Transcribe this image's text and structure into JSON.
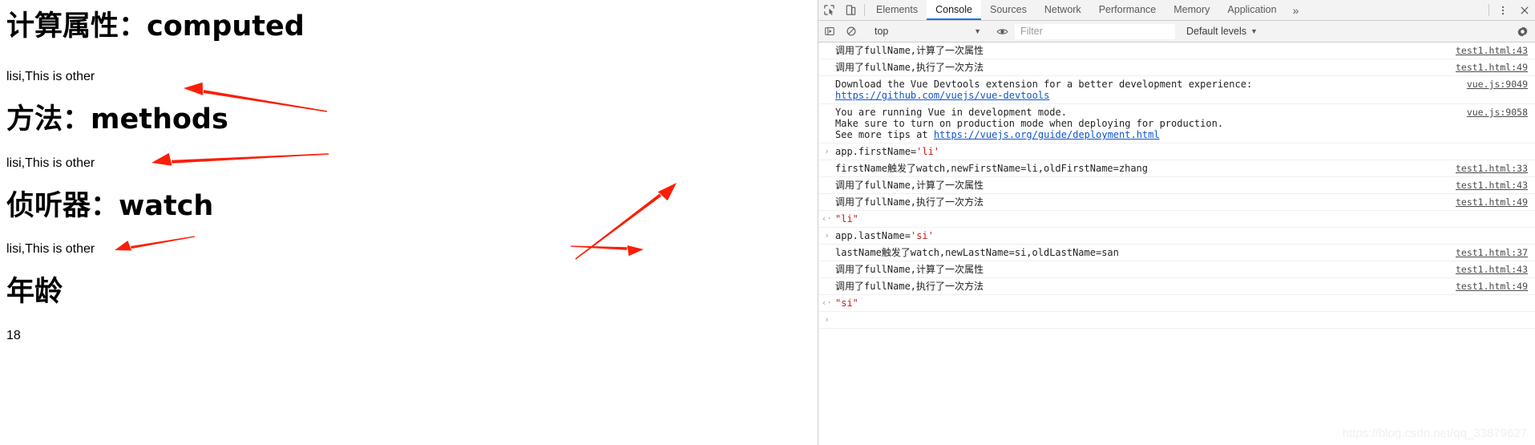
{
  "page": {
    "sections": [
      {
        "heading": "计算属性：computed",
        "value": "lisi,This is other"
      },
      {
        "heading": "方法：methods",
        "value": "lisi,This is other"
      },
      {
        "heading": "侦听器：watch",
        "value": "lisi,This is other"
      },
      {
        "heading": "年龄",
        "value": "18"
      }
    ]
  },
  "devtools": {
    "icons": {
      "inspect": "inspect-element-icon",
      "device": "device-toolbar-icon",
      "sidebar": "console-sidebar-icon",
      "clear": "clear-console-icon",
      "eye": "live-expression-icon",
      "more_tabs": "more-tabs-icon",
      "menu": "customize-devtools-icon",
      "close": "close-devtools-icon",
      "settings": "settings-gear-icon"
    },
    "tabs": [
      {
        "label": "Elements",
        "selected": false
      },
      {
        "label": "Console",
        "selected": true
      },
      {
        "label": "Sources",
        "selected": false
      },
      {
        "label": "Network",
        "selected": false
      },
      {
        "label": "Performance",
        "selected": false
      },
      {
        "label": "Memory",
        "selected": false
      },
      {
        "label": "Application",
        "selected": false
      }
    ],
    "more_tabs_label": "»",
    "filterbar": {
      "context": "top",
      "filter_placeholder": "Filter",
      "levels": "Default levels",
      "caret": "▼"
    },
    "console_rows": [
      {
        "gutter": "",
        "lines": [
          "调用了fullName,计算了一次属性"
        ],
        "source": "test1.html:43"
      },
      {
        "gutter": "",
        "lines": [
          "调用了fullName,执行了一次方法"
        ],
        "source": "test1.html:49"
      },
      {
        "gutter": "",
        "lines": [
          "Download the Vue Devtools extension for a better development experience:",
          "https://github.com/vuejs/vue-devtools"
        ],
        "link_line": 1,
        "source": "vue.js:9049"
      },
      {
        "gutter": "",
        "lines": [
          "You are running Vue in development mode.",
          "Make sure to turn on production mode when deploying for production.",
          "See more tips at https://vuejs.org/guide/deployment.html"
        ],
        "source": "vue.js:9058"
      },
      {
        "gutter": "›",
        "kind": "input",
        "expr_before": "app.firstName=",
        "expr_string": "'li'",
        "source": ""
      },
      {
        "gutter": "",
        "lines": [
          "firstName触发了watch,newFirstName=li,oldFirstName=zhang"
        ],
        "source": "test1.html:33"
      },
      {
        "gutter": "",
        "lines": [
          "调用了fullName,计算了一次属性"
        ],
        "source": "test1.html:43"
      },
      {
        "gutter": "",
        "lines": [
          "调用了fullName,执行了一次方法"
        ],
        "source": "test1.html:49"
      },
      {
        "gutter": "‹·",
        "kind": "output",
        "expr_before": "",
        "expr_string": "\"li\"",
        "source": ""
      },
      {
        "gutter": "›",
        "kind": "input",
        "expr_before": "app.lastName=",
        "expr_string": "'si'",
        "source": ""
      },
      {
        "gutter": "",
        "lines": [
          "lastName触发了watch,newLastName=si,oldLastName=san"
        ],
        "source": "test1.html:37"
      },
      {
        "gutter": "",
        "lines": [
          "调用了fullName,计算了一次属性"
        ],
        "source": "test1.html:43"
      },
      {
        "gutter": "",
        "lines": [
          "调用了fullName,执行了一次方法"
        ],
        "source": "test1.html:49"
      },
      {
        "gutter": "‹·",
        "kind": "output",
        "expr_before": "",
        "expr_string": "\"si\"",
        "source": ""
      },
      {
        "gutter": "›",
        "kind": "prompt",
        "expr_before": "",
        "expr_string": "",
        "source": ""
      }
    ]
  },
  "annotations": {
    "arrow_color": "#fb1e06",
    "arrows": [
      {
        "name": "arrow-to-computed-value"
      },
      {
        "name": "arrow-to-methods-value"
      },
      {
        "name": "arrow-to-watch-value"
      },
      {
        "name": "arrow-to-computed-log"
      },
      {
        "name": "arrow-to-lastname-log"
      }
    ]
  },
  "watermark": {
    "text": "https://blog.csdn.net/qq_33879627"
  }
}
